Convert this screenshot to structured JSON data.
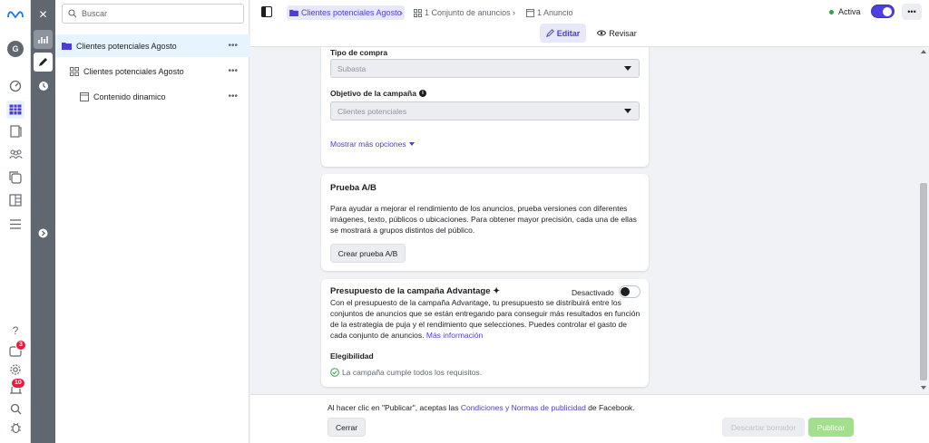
{
  "rail": {
    "notifications_badge": "3",
    "alerts_badge": "10",
    "avatar_letter": "G"
  },
  "tree": {
    "search_placeholder": "Buscar",
    "items": [
      {
        "label": "Clientes potenciales Agosto",
        "more": "•••"
      },
      {
        "label": "Clientes potenciales Agosto",
        "more": "•••"
      },
      {
        "label": "Contenido dinamico",
        "more": "•••"
      }
    ]
  },
  "topbar": {
    "crumb_campaign": "Clientes potenciales Agosto",
    "crumb_adset": "1 Conjunto de anuncios",
    "crumb_ad": "1 Anuncio",
    "status_label": "Activa",
    "edit_label": "Editar",
    "review_label": "Revisar",
    "more": "•••"
  },
  "campaign": {
    "purchase_type_label": "Tipo de compra",
    "purchase_type_value": "Subasta",
    "objective_label": "Objetivo de la campaña",
    "objective_value": "Clientes potenciales",
    "more_options": "Mostrar más opciones"
  },
  "ab_test": {
    "title": "Prueba A/B",
    "description_lines": [
      "Para ayudar a mejorar el rendimiento de los anuncios, prueba versiones con diferentes",
      "imágenes, texto, públicos o ubicaciones. Para obtener mayor precisión, cada una de ellas",
      "se mostrará a grupos distintos del público."
    ],
    "button": "Crear prueba A/B"
  },
  "budget": {
    "title": "Presupuesto de la campaña Advantage",
    "title_symbol": "✦",
    "toggle_label": "Desactivado",
    "description_lines": [
      "Con el presupuesto de la campaña Advantage, tu presupuesto se distribuirá entre los",
      "conjuntos de anuncios que se están entregando para conseguir más resultados en función",
      "de la estrategia de puja y el rendimiento que selecciones. Puedes controlar el gasto de",
      "cada conjunto de anuncios."
    ],
    "more_info": "Más información",
    "eligibility_label": "Elegibilidad",
    "eligibility_status": "La campaña cumple todos los requisitos."
  },
  "footer": {
    "terms_prefix": "Al hacer clic en \"Publicar\", aceptas las ",
    "terms_link": "Condiciones y Normas de publicidad",
    "terms_suffix": " de Facebook.",
    "close": "Cerrar",
    "discard": "Descartar borrador",
    "publish": "Publicar"
  },
  "colors": {
    "accent": "#4f3bd7",
    "toggle_on": "#4c41e0",
    "active_dot": "#31a24c",
    "publish_bg": "#a2e08c",
    "link": "#385898"
  }
}
